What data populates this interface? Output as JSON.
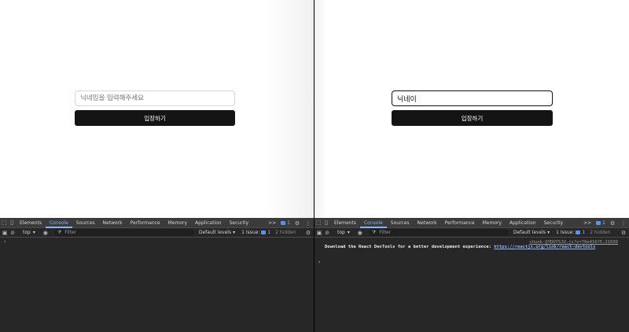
{
  "left": {
    "input": {
      "placeholder": "닉네임을 입력해주세요",
      "value": ""
    },
    "button_label": "입장하기",
    "devtools": {
      "tabs": [
        "Elements",
        "Console",
        "Sources",
        "Network",
        "Performance",
        "Memory",
        "Application",
        "Security"
      ],
      "active_tab": "Console",
      "more": ">>",
      "issue_badge": "1",
      "context": "top",
      "filter_placeholder": "Filter",
      "levels": "Default levels",
      "issues_label": "1 Issue:",
      "issues_count": "1",
      "hidden": "2 hidden",
      "prompt": "›"
    }
  },
  "right": {
    "input": {
      "placeholder": "",
      "value": "닉네이"
    },
    "button_label": "입장하기",
    "devtools": {
      "tabs": [
        "Elements",
        "Console",
        "Sources",
        "Network",
        "Performance",
        "Memory",
        "Application",
        "Security"
      ],
      "active_tab": "Console",
      "more": ">>",
      "issue_badge": "1",
      "context": "top",
      "filter_placeholder": "Filter",
      "levels": "Default levels",
      "issues_label": "1 Issue:",
      "issues_count": "1",
      "hidden": "2 hidden",
      "log_source": "chunk-QYDUY5JU.js?v=76e416f5:21609",
      "log_text": "Download the React DevTools for a better development experience: ",
      "log_link1": "https://reactjs.org/link/react-devtools",
      "prompt": "›"
    }
  },
  "colors": {
    "button_bg": "#141414",
    "devtools_bg": "#272727",
    "accent": "#8ab4f8"
  }
}
